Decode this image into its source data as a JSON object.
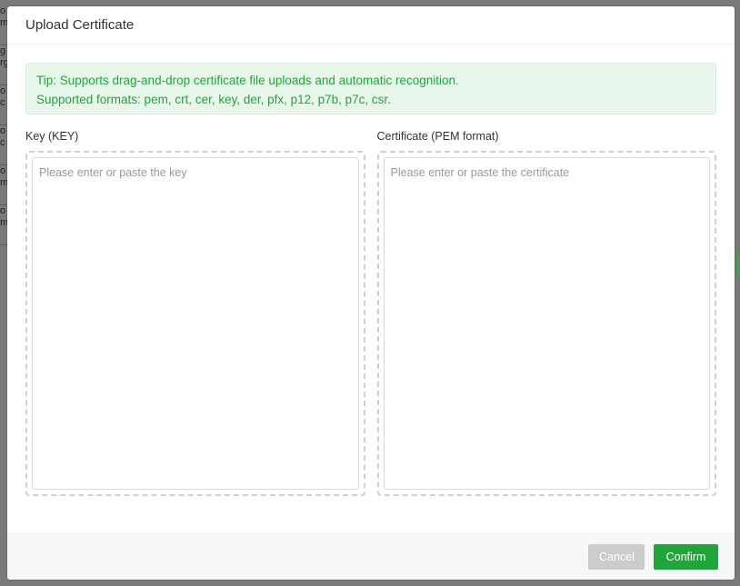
{
  "background": {
    "rows": [
      "o\nm",
      "g\nrg",
      "o\nc",
      "o\nc",
      "o\nm",
      "o\nm"
    ]
  },
  "dialog": {
    "title": "Upload Certificate",
    "tip": {
      "line1": "Tip: Supports drag-and-drop certificate file uploads and automatic recognition.",
      "line2": "Supported formats: pem, crt, cer, key, der, pfx, p12, p7b, p7c, csr."
    },
    "key_field": {
      "label": "Key (KEY)",
      "value": "",
      "placeholder": "Please enter or paste the key"
    },
    "cert_field": {
      "label": "Certificate (PEM format)",
      "value": "",
      "placeholder": "Please enter or paste the certificate"
    },
    "footer": {
      "cancel_label": "Cancel",
      "confirm_label": "Confirm"
    }
  },
  "colors": {
    "accent": "#20a53a",
    "tip_bg": "#e9f6ec",
    "cancel_bg": "#cccccc"
  }
}
